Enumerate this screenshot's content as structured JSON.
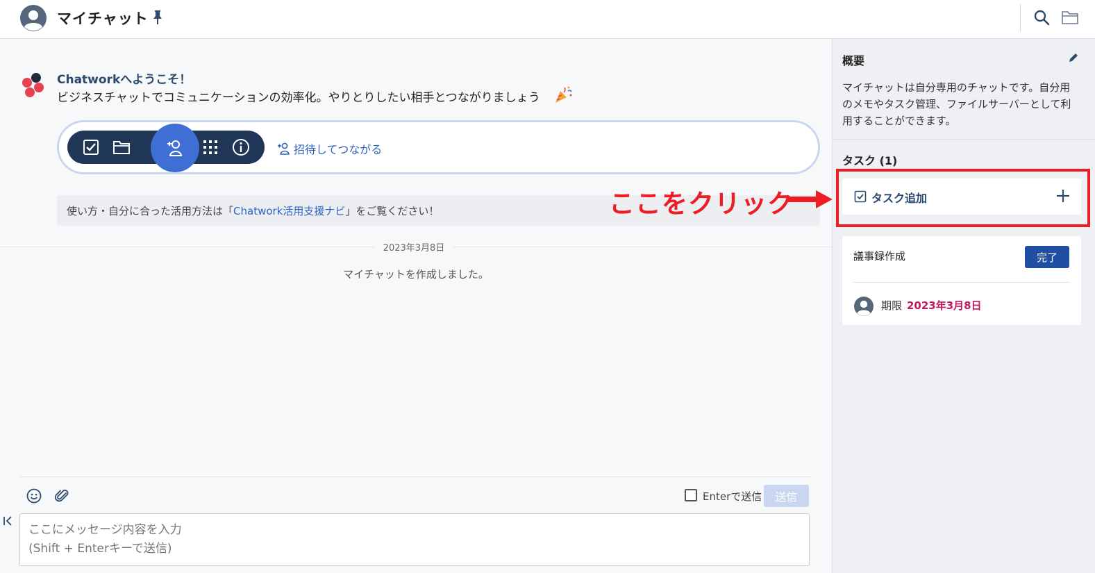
{
  "header": {
    "title": "マイチャット"
  },
  "welcome": {
    "title": "Chatworkへようこそ！",
    "text": "ビジネスチャットでコミュニケーションの効率化。やりとりしたい相手とつながりましょう"
  },
  "toolbar": {
    "invite_label": "招待してつながる"
  },
  "guide": {
    "prefix": "使い方・自分に合った活用方法は「",
    "link": "Chatwork活用支援ナビ",
    "suffix": "」をご覧ください！"
  },
  "annotation": {
    "text": "ここをクリック",
    "color": "#ee1c25"
  },
  "timeline": {
    "date": "2023年3月8日",
    "system_message": "マイチャットを作成しました。"
  },
  "composer": {
    "enter_send_label": "Enterで送信",
    "enter_send_checked": false,
    "send_label": "送信",
    "placeholder": "ここにメッセージ内容を入力\n(Shift + Enterキーで送信)"
  },
  "side": {
    "overview_title": "概要",
    "overview_text": "マイチャットは自分専用のチャットです。自分用のメモやタスク管理、ファイルサーバーとして利用することができます。",
    "task_header": "タスク (1)",
    "task_add_label": "タスク追加",
    "tasks": [
      {
        "name": "議事録作成",
        "done_label": "完了",
        "due_label": "期限",
        "due_date": "2023年3月8日"
      }
    ]
  },
  "colors": {
    "accent": "#3f6fd4",
    "nav_dark": "#1f3656",
    "due": "#c2185b",
    "highlight": "#ee1c25"
  }
}
